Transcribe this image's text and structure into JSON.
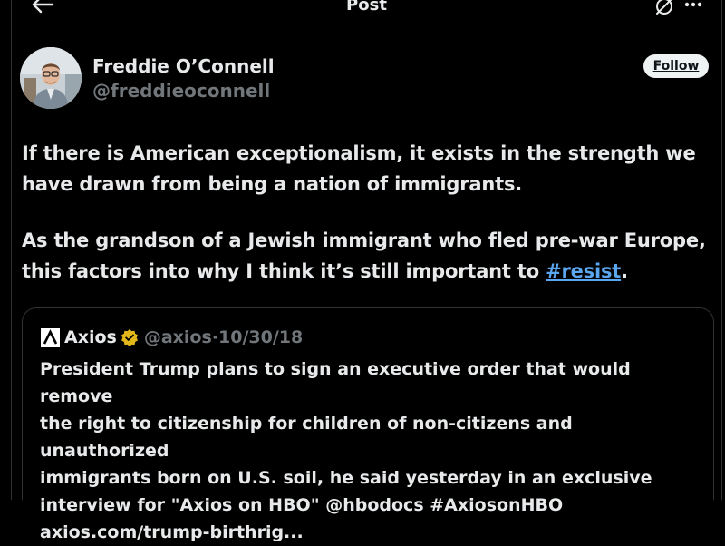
{
  "header": {
    "title": "Post",
    "back_icon": "arrow-left-icon",
    "reply_settings_icon": "reply-settings-icon",
    "more_icon": "more-horizontal-icon"
  },
  "author": {
    "name": "Freddie O’Connell",
    "handle": "@freddieoconnell",
    "follow_label": "Follow"
  },
  "post": {
    "paragraph1": "If there is American exceptionalism, it exists in the strength we have drawn from being a nation of immigrants.",
    "paragraph2_before": "As the grandson of a Jewish immigrant who fled pre-war Europe, this factors into why I think it’s still important to ",
    "hashtag": "#resist",
    "paragraph2_after": "."
  },
  "quote": {
    "name": "Axios",
    "handle": "@axios",
    "separator": "·",
    "date": "10/30/18",
    "text_lines": [
      "President Trump plans to sign an executive order that would remove",
      "the right to citizenship for children of non-citizens and unauthorized",
      "immigrants born on U.S. soil, he said yesterday in an exclusive",
      "interview for \"Axios on HBO\" @hbodocs #AxiosonHBO",
      "axios.com/trump-birthrig..."
    ]
  },
  "colors": {
    "background": "#000000",
    "text": "#e7e9ea",
    "muted": "#71767b",
    "link": "#5ba6f0",
    "verified": "#e2b719",
    "border": "#2f3336"
  }
}
